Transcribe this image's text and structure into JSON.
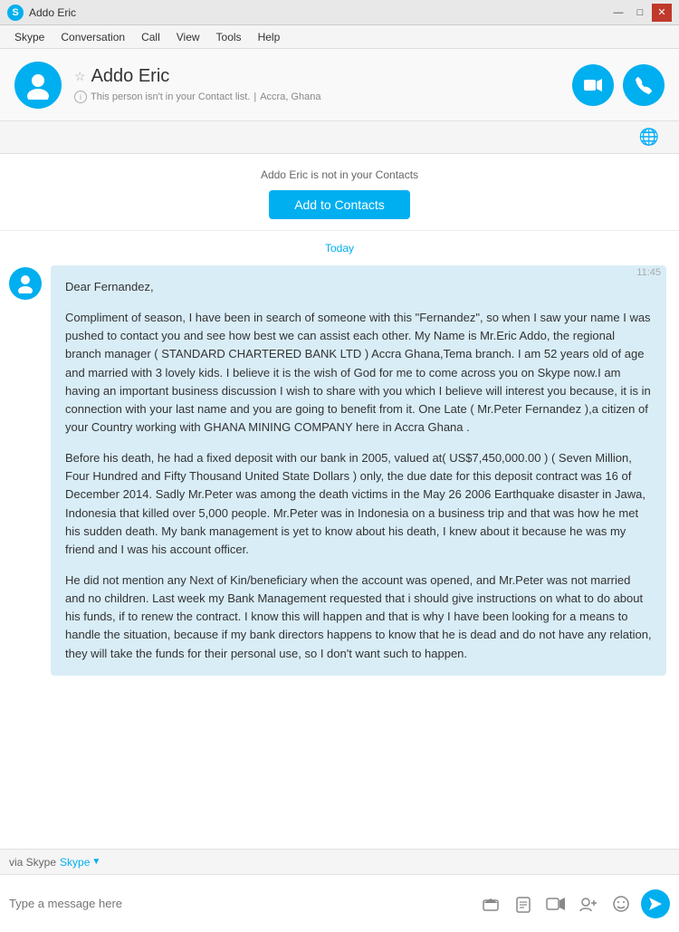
{
  "titleBar": {
    "title": "Addo Eric",
    "minimize": "—",
    "maximize": "□",
    "close": "✕"
  },
  "menuBar": {
    "items": [
      "Skype",
      "Conversation",
      "Call",
      "View",
      "Tools",
      "Help"
    ]
  },
  "contact": {
    "name": "Addo Eric",
    "subtitle": "This person isn't in your Contact list.",
    "location": "Accra, Ghana",
    "notInContacts": "Addo Eric is not in your Contacts",
    "addToContacts": "Add to Contacts"
  },
  "chat": {
    "dateDivider": "Today",
    "messageTime": "11:45",
    "messageParagraphs": [
      "Dear Fernandez,",
      "Compliment of season, I have been in search of someone with this \"Fernandez\", so when I saw your name I was pushed to contact you and see how best we can assist each other. My Name is Mr.Eric Addo, the regional branch manager ( STANDARD CHARTERED BANK LTD ) Accra Ghana,Tema branch. I am 52 years old of age and married with 3 lovely kids. I believe it is the wish of God for me to come across you on Skype now.I am having an important business discussion I wish to share with you which I believe will interest you because, it is in connection with your last name and you are going to benefit from it. One Late ( Mr.Peter Fernandez ),a citizen of your Country working with GHANA MINING COMPANY here in Accra Ghana .",
      "Before his death, he had a fixed deposit with our bank in 2005, valued at( US$7,450,000.00 ) ( Seven Million, Four Hundred and Fifty Thousand United State Dollars ) only, the due date for this deposit contract was 16 of December 2014. Sadly Mr.Peter was among the death victims in the May 26 2006 Earthquake disaster in Jawa, Indonesia that killed over 5,000 people. Mr.Peter was in Indonesia on a business trip and that was how he met his sudden death. My bank management is yet to know about his death, I knew about it because he was my friend and I was his account officer.",
      "He did not mention any Next of Kin/beneficiary when the account was opened, and Mr.Peter was not married and no children. Last week my Bank Management requested that i should give instructions on what to do about his funds, if to renew the contract. I know this will happen and that is why I have been looking for a means to handle the situation, because if my bank directors happens to know that he is dead and do not have any relation, they will take the funds for their personal use, so I don't want such to happen."
    ]
  },
  "inputArea": {
    "placeholder": "Type a message here",
    "viaSkype": "via Skype"
  }
}
